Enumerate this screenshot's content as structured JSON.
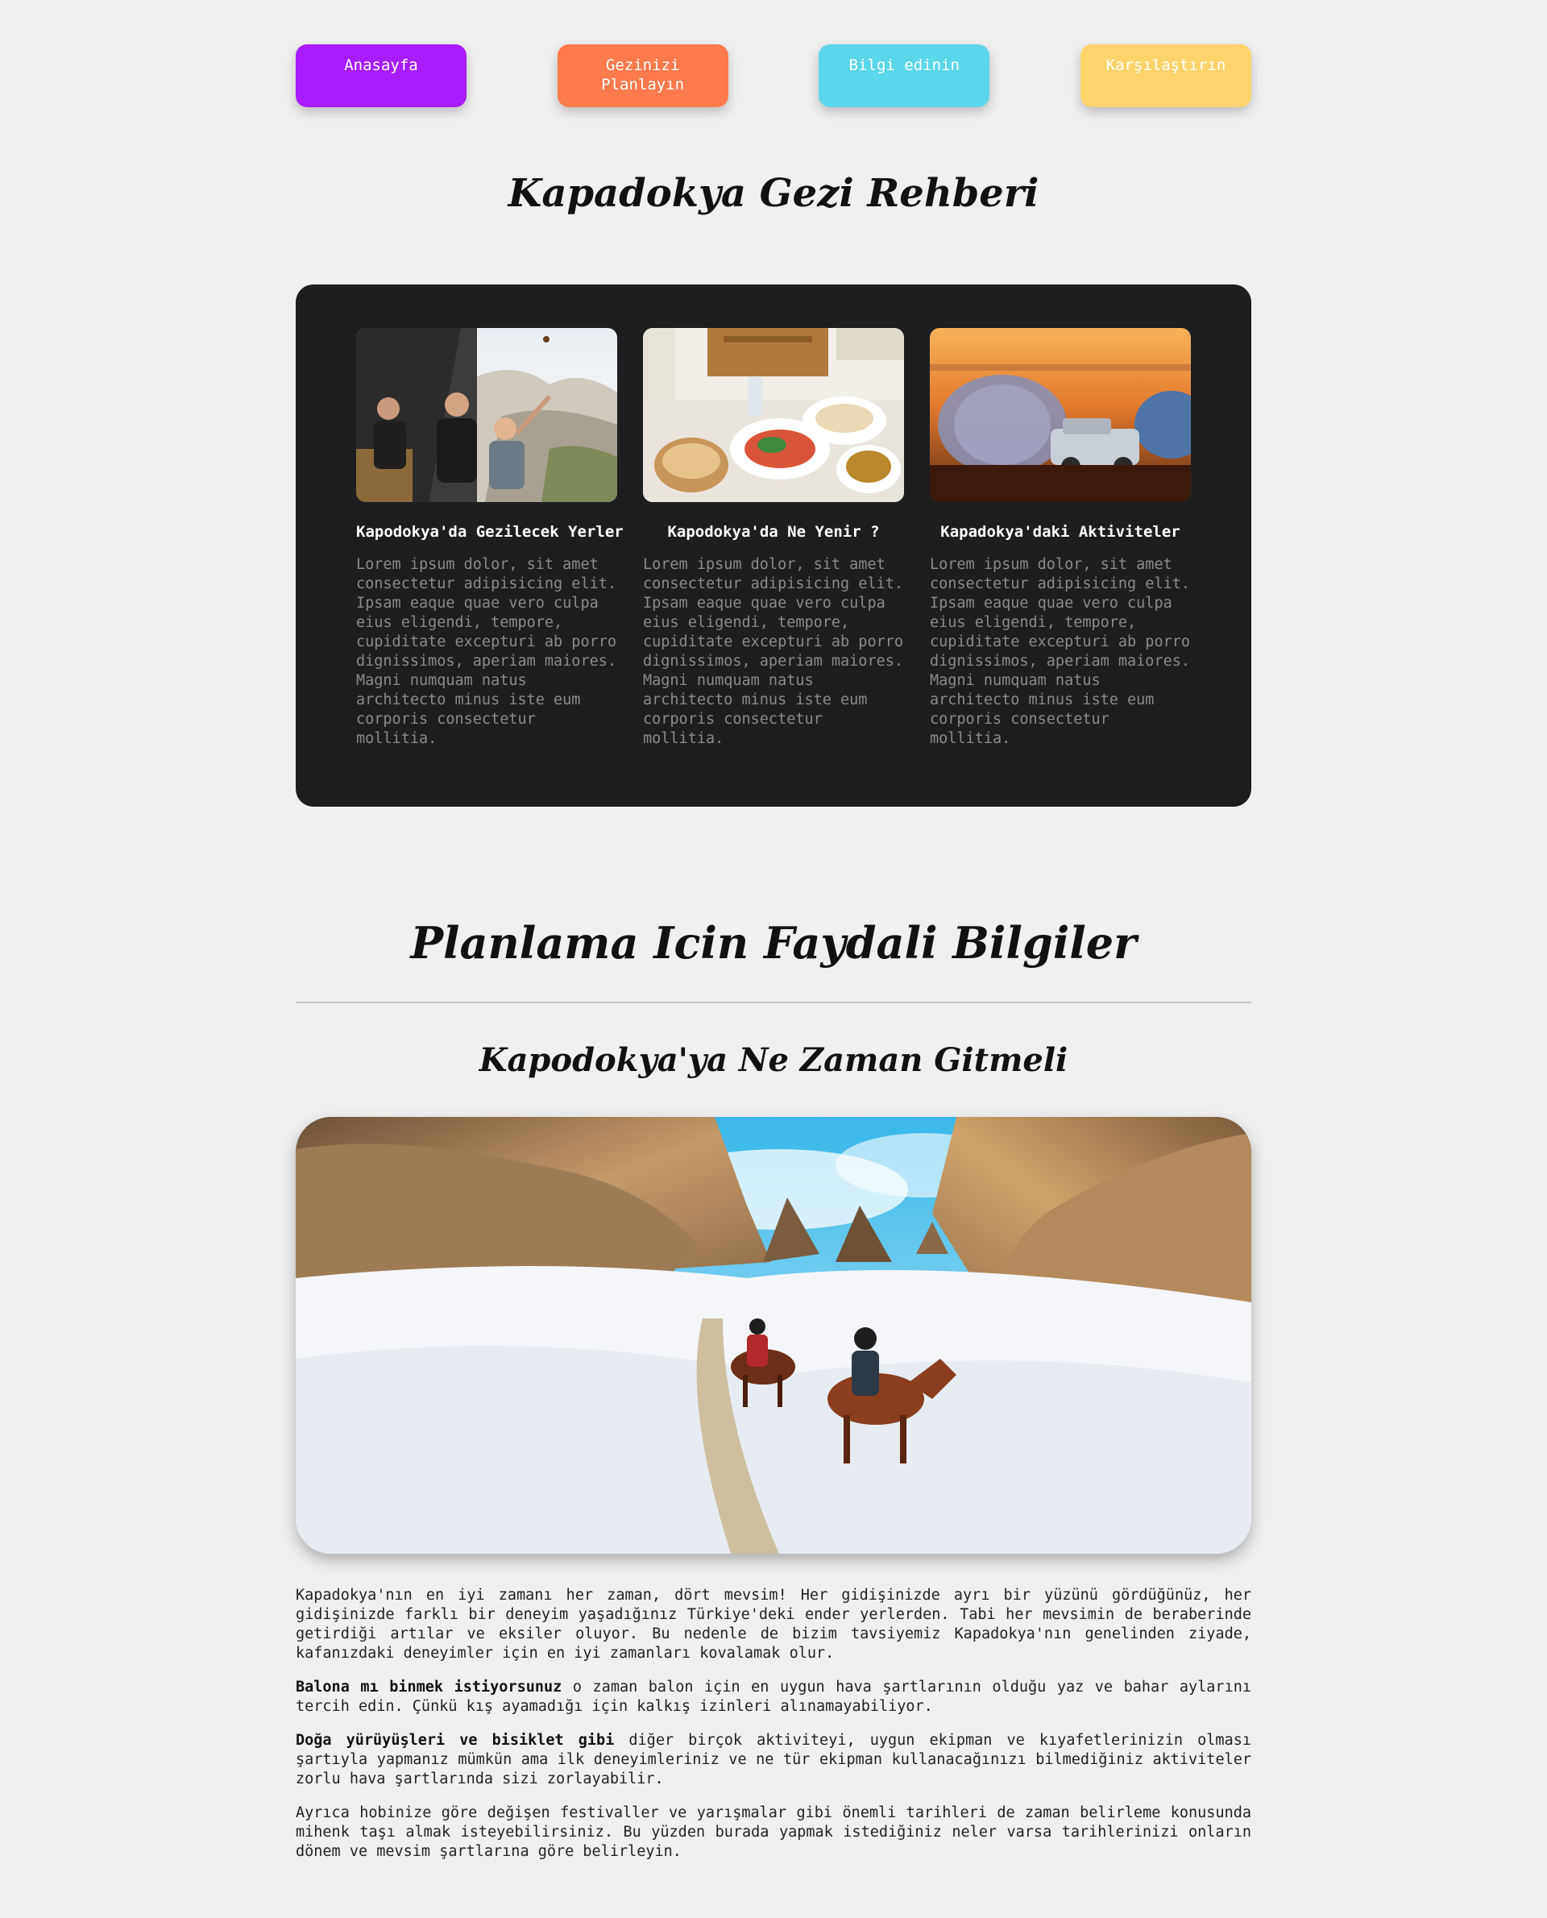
{
  "nav": {
    "items": [
      {
        "label": "Anasayfa",
        "color": "#a81cff"
      },
      {
        "label": "Gezinizi Planlayın",
        "color": "#ff7a4d"
      },
      {
        "label": "Bilgi edinin",
        "color": "#5bd6ea"
      },
      {
        "label": "Karşılaştırın",
        "color": "#ffd36b"
      }
    ]
  },
  "header": {
    "title": "Kapadokya Gezi Rehberi"
  },
  "cards": [
    {
      "title": "Kapodokya'da Gezilecek Yerler",
      "image": "balloon-basket-people-photo",
      "text": "Lorem ipsum dolor, sit amet consectetur adipisicing elit. Ipsam eaque quae vero culpa eius eligendi, tempore, cupiditate excepturi ab porro dignissimos, aperiam maiores. Magni numquam natus architecto minus iste eum corporis consectetur mollitia."
    },
    {
      "title": "Kapodokya'da Ne Yenir ?",
      "image": "food-plates-photo",
      "text": "Lorem ipsum dolor, sit amet consectetur adipisicing elit. Ipsam eaque quae vero culpa eius eligendi, tempore, cupiditate excepturi ab porro dignissimos, aperiam maiores. Magni numquam natus architecto minus iste eum corporis consectetur mollitia."
    },
    {
      "title": "Kapadokya'daki Aktiviteler",
      "image": "sunset-balloons-jeep-photo",
      "text": "Lorem ipsum dolor, sit amet consectetur adipisicing elit. Ipsam eaque quae vero culpa eius eligendi, tempore, cupiditate excepturi ab porro dignissimos, aperiam maiores. Magni numquam natus architecto minus iste eum corporis consectetur mollitia."
    }
  ],
  "planning": {
    "title": "Planlama Icin Faydali Bilgiler",
    "subtitle": "Kapodokya'ya Ne Zaman Gitmeli",
    "hero_image": "winter-horse-riding-photo",
    "p1": "Kapadokya'nın en iyi zamanı her zaman, dört mevsim! Her gidişinizde ayrı bir yüzünü gördüğünüz, her gidişinizde farklı bir deneyim yaşadığınız Türkiye'deki ender yerlerden. Tabi her mevsimin de beraberinde getirdiği artılar ve eksiler oluyor. Bu nedenle de bizim tavsiyemiz Kapadokya'nın genelinden ziyade, kafanızdaki deneyimler için en iyi zamanları kovalamak olur.",
    "p2_bold": "Balona mı binmek istiyorsunuz",
    "p2_text": " o zaman balon için en uygun hava şartlarının olduğu yaz ve bahar aylarını tercih edin. Çünkü kış ayamadığı için kalkış izinleri alınamayabiliyor.",
    "p3_bold": "Doğa yürüyüşleri ve bisiklet gibi",
    "p3_text": " diğer birçok aktiviteyi, uygun ekipman ve kıyafetlerinizin olması şartıyla yapmanız mümkün ama ilk deneyimleriniz ve ne tür ekipman kullanacağınızı bilmediğiniz aktiviteler zorlu hava şartlarında sizi zorlayabilir.",
    "p4": "Ayrıca hobinize göre değişen festivaller ve yarışmalar gibi önemli tarihleri de zaman belirleme konusunda mihenk taşı almak isteyebilirsiniz. Bu yüzden burada yapmak istediğiniz neler varsa tarihlerinizi onların dönem ve mevsim şartlarına göre belirleyin."
  }
}
